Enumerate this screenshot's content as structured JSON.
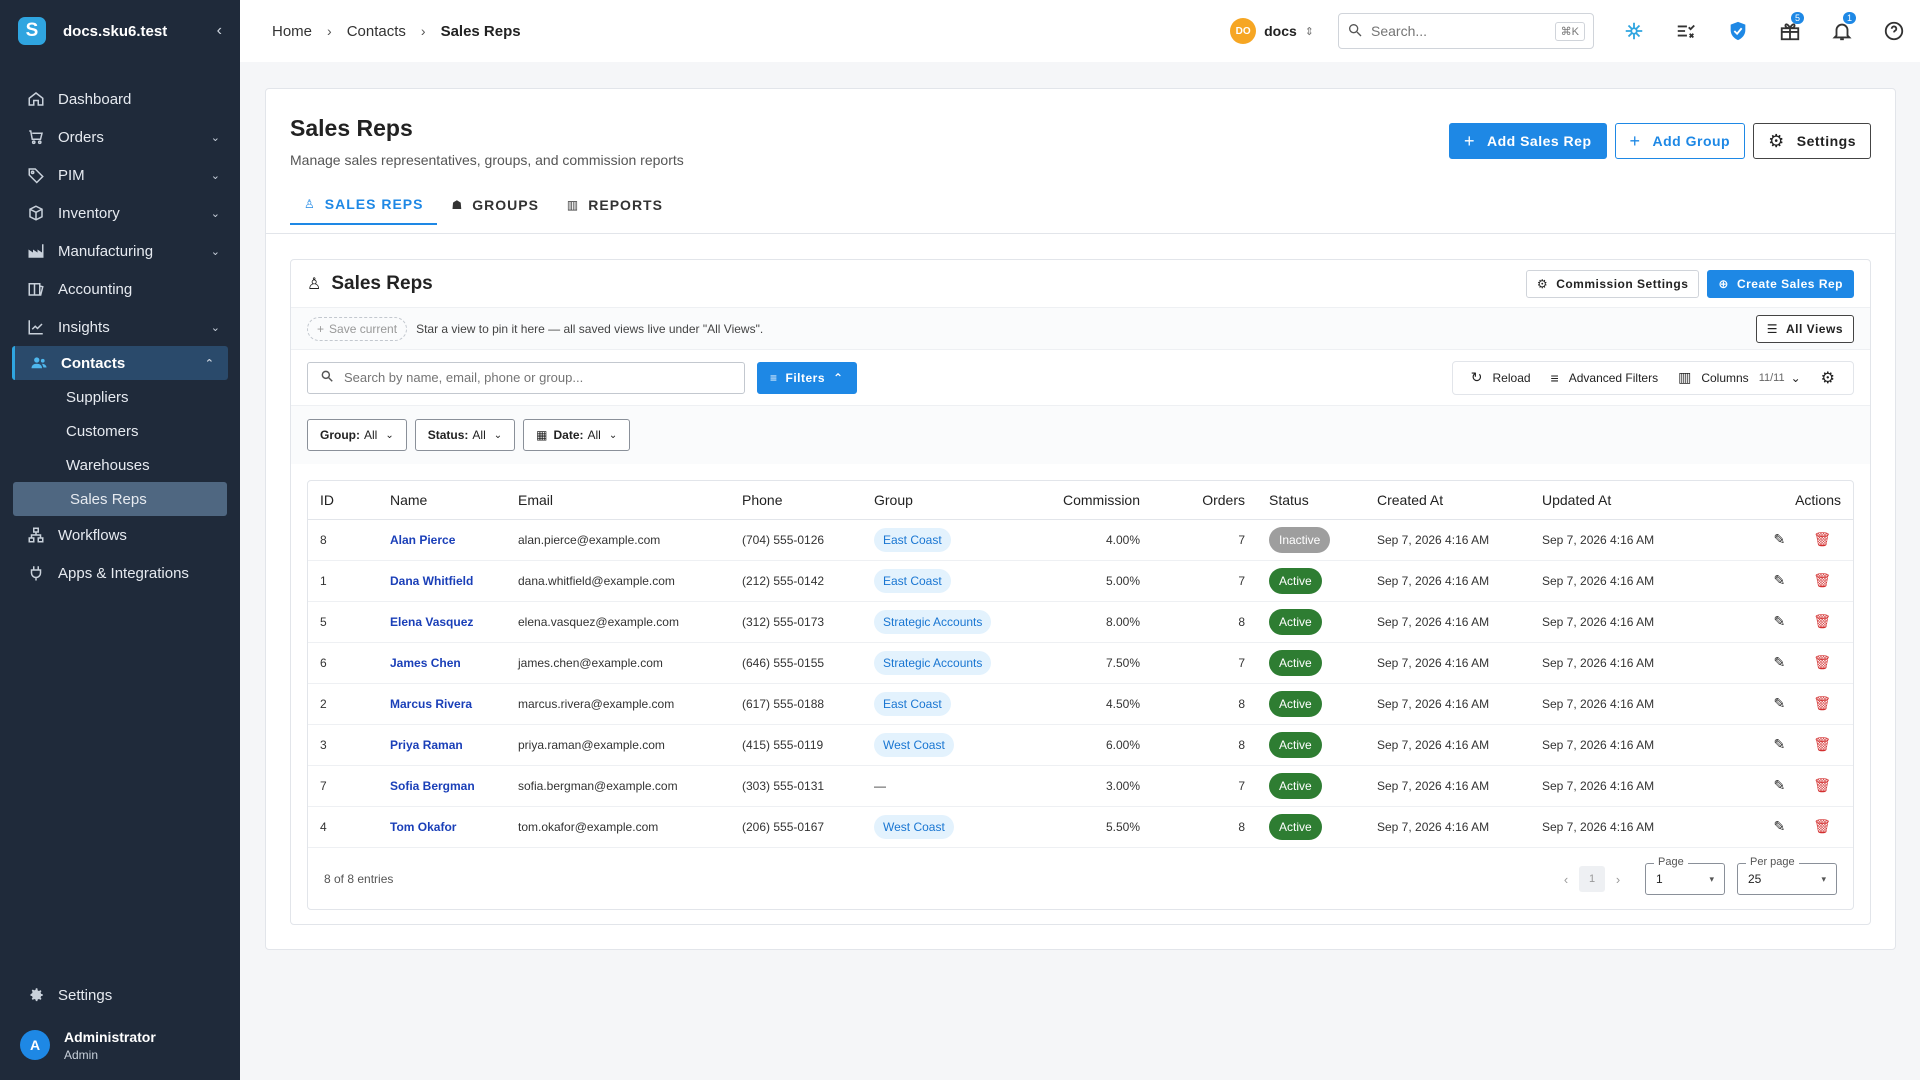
{
  "app": {
    "name": "docs.sku6.test",
    "logo_letter": "S",
    "collapse_glyph": "‹"
  },
  "sidebar": {
    "items": [
      {
        "label": "Dashboard",
        "icon": "home-icon",
        "chev": ""
      },
      {
        "label": "Orders",
        "icon": "cart-icon",
        "chev": "⌄"
      },
      {
        "label": "PIM",
        "icon": "tag-icon",
        "chev": "⌄"
      },
      {
        "label": "Inventory",
        "icon": "box-icon",
        "chev": "⌄"
      },
      {
        "label": "Manufacturing",
        "icon": "factory-icon",
        "chev": "⌄"
      },
      {
        "label": "Accounting",
        "icon": "book-icon",
        "chev": ""
      },
      {
        "label": "Insights",
        "icon": "chart-icon",
        "chev": "⌄"
      },
      {
        "label": "Contacts",
        "icon": "people-icon",
        "chev": "⌃"
      }
    ],
    "contacts_sub": [
      "Suppliers",
      "Customers",
      "Warehouses",
      "Sales Reps"
    ],
    "after": [
      {
        "label": "Workflows",
        "icon": "workflow-icon"
      },
      {
        "label": "Apps & Integrations",
        "icon": "plug-icon"
      }
    ],
    "settings_label": "Settings",
    "user": {
      "initial": "A",
      "name": "Administrator",
      "role": "Admin"
    }
  },
  "topbar": {
    "breadcrumb": [
      "Home",
      "Contacts",
      "Sales Reps"
    ],
    "breadcrumb_sep": "›",
    "workspace": {
      "initials": "DO",
      "name": "docs",
      "switch_glyph": "⇕"
    },
    "search_placeholder": "Search...",
    "search_shortcut": "⌘K",
    "badges": {
      "gifts": "5",
      "notifications": "1"
    }
  },
  "page": {
    "title": "Sales Reps",
    "subtitle": "Manage sales representatives, groups, and commission reports",
    "actions": {
      "add_rep": "Add Sales Rep",
      "add_group": "Add Group",
      "settings": "Settings",
      "plus_glyph": "+",
      "gear_glyph": "⚙"
    },
    "tabs": [
      {
        "label": "SALES REPS",
        "icon": "♙"
      },
      {
        "label": "GROUPS",
        "icon": "☗"
      },
      {
        "label": "REPORTS",
        "icon": "▥"
      }
    ]
  },
  "panel": {
    "title": "Sales Reps",
    "title_icon": "♙",
    "commission_settings": "Commission Settings",
    "create_rep": "Create Sales Rep",
    "gear_glyph": "⚙",
    "create_glyph": "⊕",
    "save_current": "Save current",
    "save_glyph": "+",
    "views_hint": "Star a view to pin it here — all saved views live under \"All Views\".",
    "all_views": "All Views",
    "all_views_glyph": "☰",
    "search_placeholder": "Search by name, email, phone or group...",
    "search_glyph": "⌕",
    "filters_label": "Filters",
    "filters_glyph": "≡",
    "filters_caret": "⌃",
    "toolbar": {
      "reload": "Reload",
      "reload_glyph": "↻",
      "advanced": "Advanced Filters",
      "advanced_glyph": "≡",
      "columns": "Columns",
      "columns_glyph": "▥",
      "columns_count": "11/11",
      "columns_caret": "⌄",
      "gear_glyph": "⚙"
    },
    "chips": [
      {
        "key": "Group:",
        "value": "All",
        "glyph": ""
      },
      {
        "key": "Status:",
        "value": "All",
        "glyph": ""
      },
      {
        "key": "Date:",
        "value": "All",
        "glyph": "▦"
      }
    ],
    "chip_caret": "⌄"
  },
  "table": {
    "columns": [
      "ID",
      "Name",
      "Email",
      "Phone",
      "Group",
      "Commission",
      "Orders",
      "Status",
      "Created At",
      "Updated At",
      "Actions"
    ],
    "rows": [
      {
        "id": "8",
        "name": "Alan Pierce",
        "email": "alan.pierce@example.com",
        "phone": "(704) 555-0126",
        "group": "East Coast",
        "commission": "4.00%",
        "orders": "7",
        "status": "Inactive",
        "created": "Sep 7, 2026 4:16 AM",
        "updated": "Sep 7, 2026 4:16 AM"
      },
      {
        "id": "1",
        "name": "Dana Whitfield",
        "email": "dana.whitfield@example.com",
        "phone": "(212) 555-0142",
        "group": "East Coast",
        "commission": "5.00%",
        "orders": "7",
        "status": "Active",
        "created": "Sep 7, 2026 4:16 AM",
        "updated": "Sep 7, 2026 4:16 AM"
      },
      {
        "id": "5",
        "name": "Elena Vasquez",
        "email": "elena.vasquez@example.com",
        "phone": "(312) 555-0173",
        "group": "Strategic Accounts",
        "commission": "8.00%",
        "orders": "8",
        "status": "Active",
        "created": "Sep 7, 2026 4:16 AM",
        "updated": "Sep 7, 2026 4:16 AM"
      },
      {
        "id": "6",
        "name": "James Chen",
        "email": "james.chen@example.com",
        "phone": "(646) 555-0155",
        "group": "Strategic Accounts",
        "commission": "7.50%",
        "orders": "7",
        "status": "Active",
        "created": "Sep 7, 2026 4:16 AM",
        "updated": "Sep 7, 2026 4:16 AM"
      },
      {
        "id": "2",
        "name": "Marcus Rivera",
        "email": "marcus.rivera@example.com",
        "phone": "(617) 555-0188",
        "group": "East Coast",
        "commission": "4.50%",
        "orders": "8",
        "status": "Active",
        "created": "Sep 7, 2026 4:16 AM",
        "updated": "Sep 7, 2026 4:16 AM"
      },
      {
        "id": "3",
        "name": "Priya Raman",
        "email": "priya.raman@example.com",
        "phone": "(415) 555-0119",
        "group": "West Coast",
        "commission": "6.00%",
        "orders": "8",
        "status": "Active",
        "created": "Sep 7, 2026 4:16 AM",
        "updated": "Sep 7, 2026 4:16 AM"
      },
      {
        "id": "7",
        "name": "Sofia Bergman",
        "email": "sofia.bergman@example.com",
        "phone": "(303) 555-0131",
        "group": "—",
        "commission": "3.00%",
        "orders": "7",
        "status": "Active",
        "created": "Sep 7, 2026 4:16 AM",
        "updated": "Sep 7, 2026 4:16 AM"
      },
      {
        "id": "4",
        "name": "Tom Okafor",
        "email": "tom.okafor@example.com",
        "phone": "(206) 555-0167",
        "group": "West Coast",
        "commission": "5.50%",
        "orders": "8",
        "status": "Active",
        "created": "Sep 7, 2026 4:16 AM",
        "updated": "Sep 7, 2026 4:16 AM"
      }
    ],
    "edit_glyph": "✎",
    "delete_glyph": "🗑",
    "footer": {
      "entries": "8 of 8 entries",
      "prev_glyph": "‹",
      "next_glyph": "›",
      "current_page": "1",
      "page_label": "Page",
      "page_value": "1",
      "per_page_label": "Per page",
      "per_page_value": "25",
      "select_caret": "▾"
    }
  },
  "colors": {
    "sidebar_bg": "#1f2a3a",
    "accent": "#1e88e5",
    "active_status": "#2e7d32",
    "inactive_status": "#9e9e9e",
    "delete": "#d32f2f",
    "workspace_avatar": "#f6a623"
  }
}
